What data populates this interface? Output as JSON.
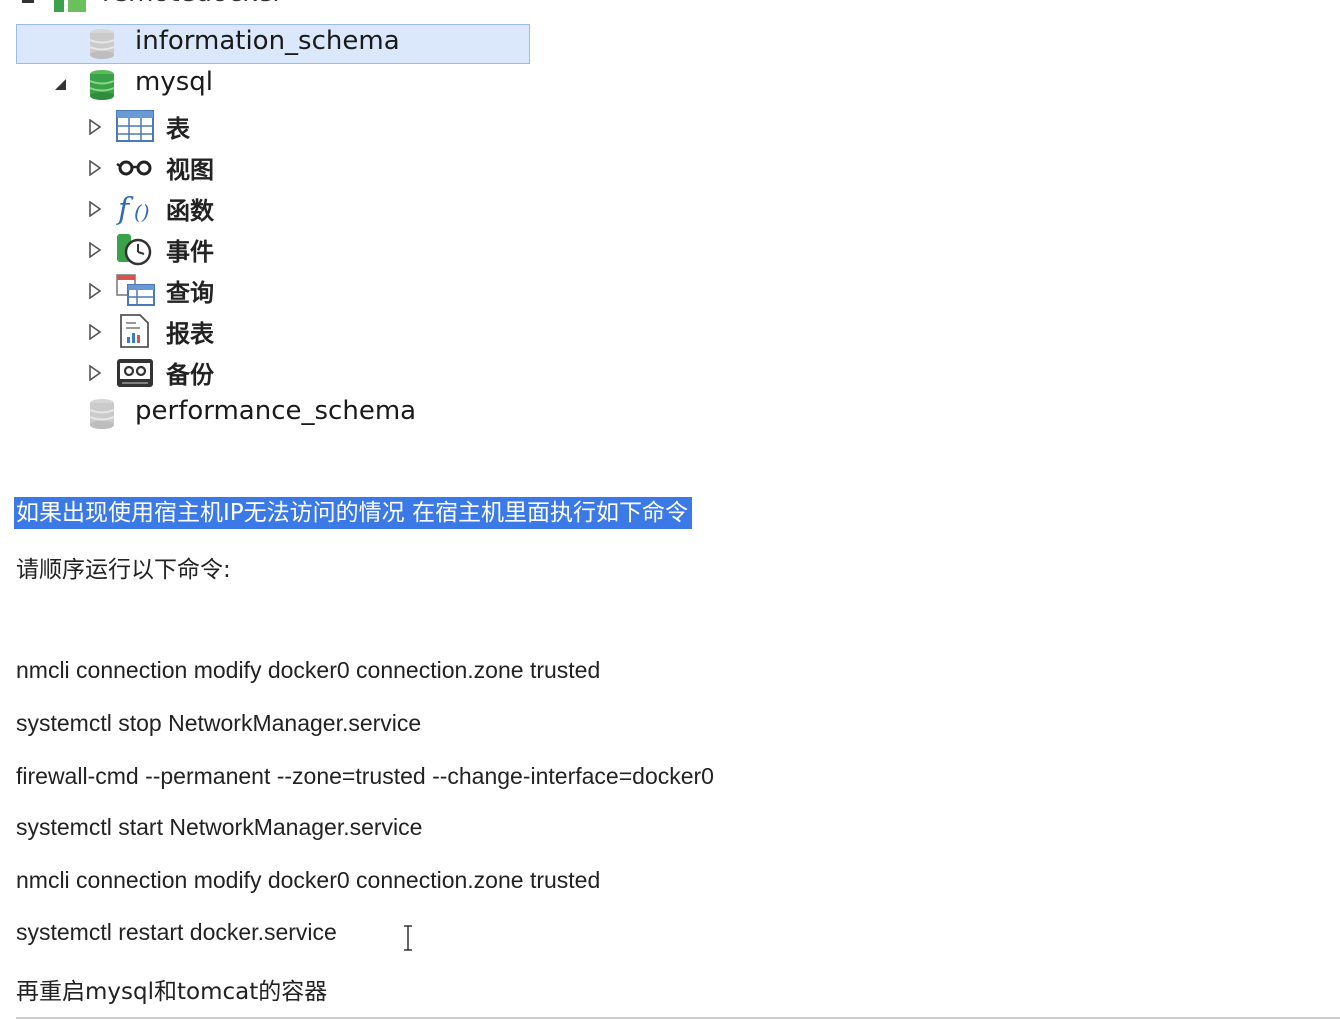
{
  "tree": {
    "connection_label": "remotedocker",
    "databases": [
      {
        "name": "information_schema"
      },
      {
        "name": "mysql"
      },
      {
        "name": "performance_schema"
      }
    ],
    "mysql_children": [
      {
        "label": "表",
        "icon": "table-icon"
      },
      {
        "label": "视图",
        "icon": "view-glasses-icon"
      },
      {
        "label": "函数",
        "icon": "function-icon"
      },
      {
        "label": "事件",
        "icon": "event-clock-icon"
      },
      {
        "label": "查询",
        "icon": "query-icon"
      },
      {
        "label": "报表",
        "icon": "report-icon"
      },
      {
        "label": "备份",
        "icon": "backup-icon"
      }
    ]
  },
  "doc": {
    "highlight_line": "如果出现使用宿主机IP无法访问的情况 在宿主机里面执行如下命令",
    "intro_line": "请顺序运行以下命令:",
    "commands": [
      "nmcli connection modify docker0 connection.zone trusted",
      "systemctl stop NetworkManager.service",
      "firewall-cmd --permanent --zone=trusted --change-interface=docker0",
      "systemctl start NetworkManager.service",
      "nmcli connection modify docker0 connection.zone trusted",
      "systemctl restart docker.service"
    ],
    "final_line": "再重启mysql和tomcat的容器"
  },
  "colors": {
    "selection_bg": "#dbe7fb",
    "highlight_bg": "#3b7ae6",
    "db_green": "#3aa34a",
    "db_gray": "#c8c8c8"
  }
}
